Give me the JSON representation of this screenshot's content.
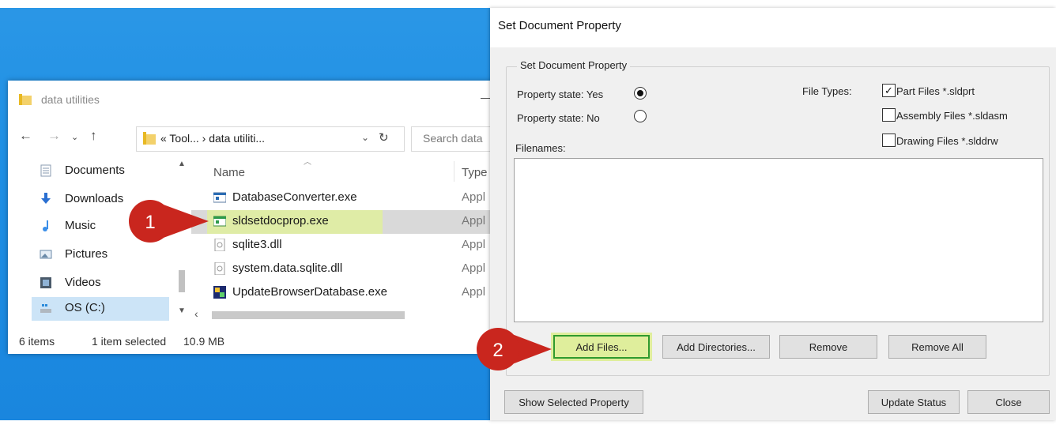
{
  "explorer": {
    "title": "data utilities",
    "address": {
      "crumb": "« Tool... › data utiliti...",
      "search_placeholder": "Search data"
    },
    "nav": {
      "items": [
        {
          "label": "Documents",
          "icon": "documents-icon"
        },
        {
          "label": "Downloads",
          "icon": "downloads-icon"
        },
        {
          "label": "Music",
          "icon": "music-icon"
        },
        {
          "label": "Pictures",
          "icon": "pictures-icon"
        },
        {
          "label": "Videos",
          "icon": "videos-icon"
        },
        {
          "label": "OS (C:)",
          "icon": "drive-icon"
        }
      ]
    },
    "columns": {
      "name": "Name",
      "type": "Type"
    },
    "files": [
      {
        "name": "DatabaseConverter.exe",
        "type": "Appl"
      },
      {
        "name": "sldsetdocprop.exe",
        "type": "Appl"
      },
      {
        "name": "sqlite3.dll",
        "type": "Appl"
      },
      {
        "name": "system.data.sqlite.dll",
        "type": "Appl"
      },
      {
        "name": "UpdateBrowserDatabase.exe",
        "type": "Appl"
      }
    ],
    "status": {
      "count": "6 items",
      "selected": "1 item selected",
      "size": "10.9 MB"
    }
  },
  "dialog": {
    "title": "Set Document Property",
    "group_label": "Set Document Property",
    "property_yes": "Property state: Yes",
    "property_no": "Property state: No",
    "file_types_label": "File Types:",
    "file_types": [
      {
        "label": "Part Files *.sldprt",
        "checked": true
      },
      {
        "label": "Assembly Files *.sldasm",
        "checked": false
      },
      {
        "label": "Drawing Files *.slddrw",
        "checked": false
      }
    ],
    "filenames_label": "Filenames:",
    "buttons": {
      "add_files": "Add Files...",
      "add_directories": "Add Directories...",
      "remove": "Remove",
      "remove_all": "Remove All",
      "show_selected": "Show Selected Property",
      "update_status": "Update Status",
      "close": "Close"
    }
  },
  "callouts": {
    "one": "1",
    "two": "2",
    "color": "#c9261e"
  }
}
